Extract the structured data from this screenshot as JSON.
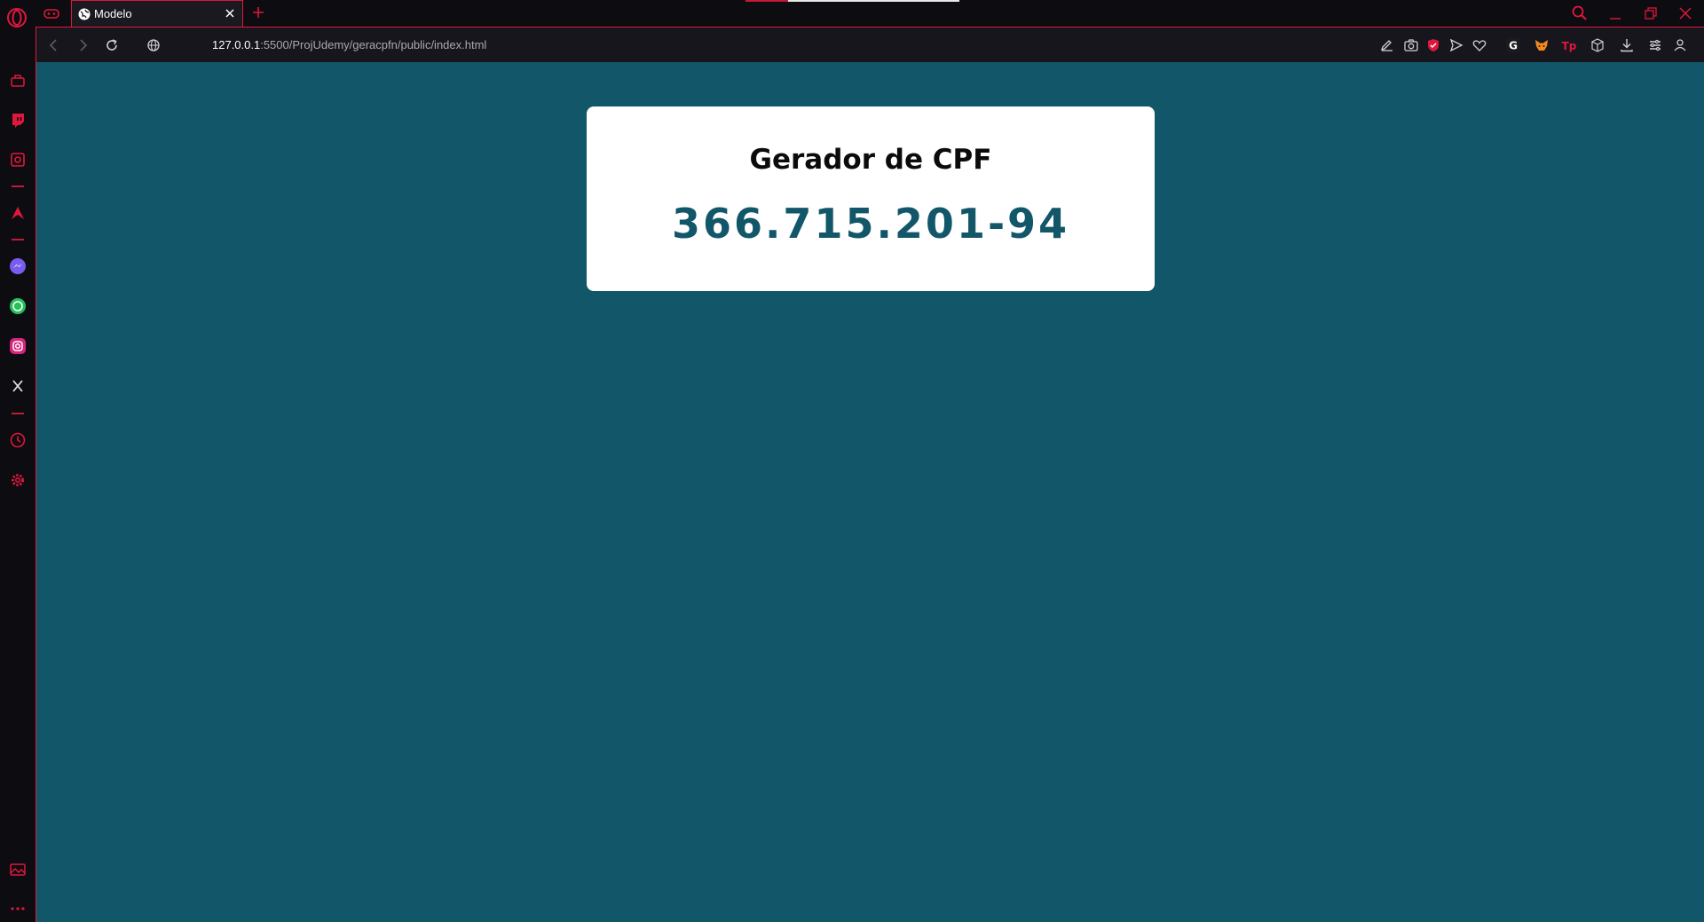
{
  "browser": {
    "tab": {
      "title": "Modelo"
    },
    "address": {
      "host": "127.0.0.1",
      "path": ":5500/ProjUdemy/geracpfn/public/index.html"
    },
    "accent_color": "#e0173d",
    "sidebar_icons": [
      "workspaces-icon",
      "twitch-icon",
      "player-icon",
      "aria-icon",
      "messenger-icon",
      "whatsapp-icon",
      "instagram-icon",
      "x-icon",
      "history-icon",
      "settings-icon",
      "gallery-icon",
      "more-icon"
    ],
    "toolbar_icons": [
      "edit-icon",
      "camera-icon",
      "vpn-shield-icon",
      "send-icon",
      "heart-icon",
      "grammarly-icon",
      "metamask-icon",
      "tp-icon",
      "cube-icon",
      "download-icon",
      "easy-setup-icon",
      "profile-icon"
    ]
  },
  "page": {
    "background_color": "#125669",
    "heading": "Gerador de CPF",
    "cpf": "366.715.201-94"
  }
}
